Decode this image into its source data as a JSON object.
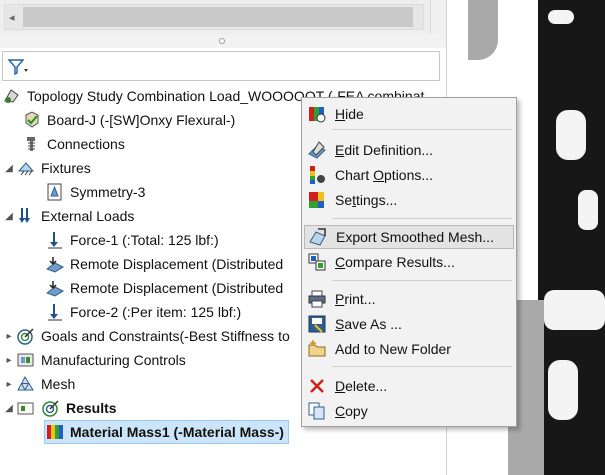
{
  "tree": {
    "study": "Topology Study Combination Load_WOOOOOT (-FEA combinat",
    "board": "Board-J (-[SW]Onxy Flexural-)",
    "connections": "Connections",
    "fixtures": "Fixtures",
    "symmetry": "Symmetry-3",
    "external_loads": "External Loads",
    "force1": "Force-1 (:Total: 125 lbf:)",
    "remote1": "Remote Displacement (Distributed",
    "remote2": "Remote Displacement (Distributed",
    "force2": "Force-2 (:Per item: 125 lbf:)",
    "goals": "Goals and Constraints(-Best Stiffness to",
    "manufacturing": "Manufacturing Controls",
    "mesh": "Mesh",
    "results": "Results",
    "material_mass": "Material Mass1 (-Material Mass-)"
  },
  "menu": {
    "hide": [
      "H",
      "ide"
    ],
    "edit_definition": [
      "E",
      "dit Definition..."
    ],
    "chart_options": [
      "Chart ",
      "O",
      "ptions..."
    ],
    "settings": [
      "Se",
      "t",
      "tings..."
    ],
    "export_mesh": "Export Smoothed Mesh...",
    "compare": [
      "C",
      "ompare Results..."
    ],
    "print": [
      "P",
      "rint..."
    ],
    "save_as": [
      "S",
      "ave As ..."
    ],
    "add_folder": "Add to New Folder",
    "delete": [
      "D",
      "elete..."
    ],
    "copy": [
      "C",
      "opy"
    ]
  },
  "colors": {
    "selection": "#cce4f7",
    "menu_bg": "#f2f2f2",
    "highlight": "#e3e3e3",
    "delete_red": "#d0201a"
  }
}
